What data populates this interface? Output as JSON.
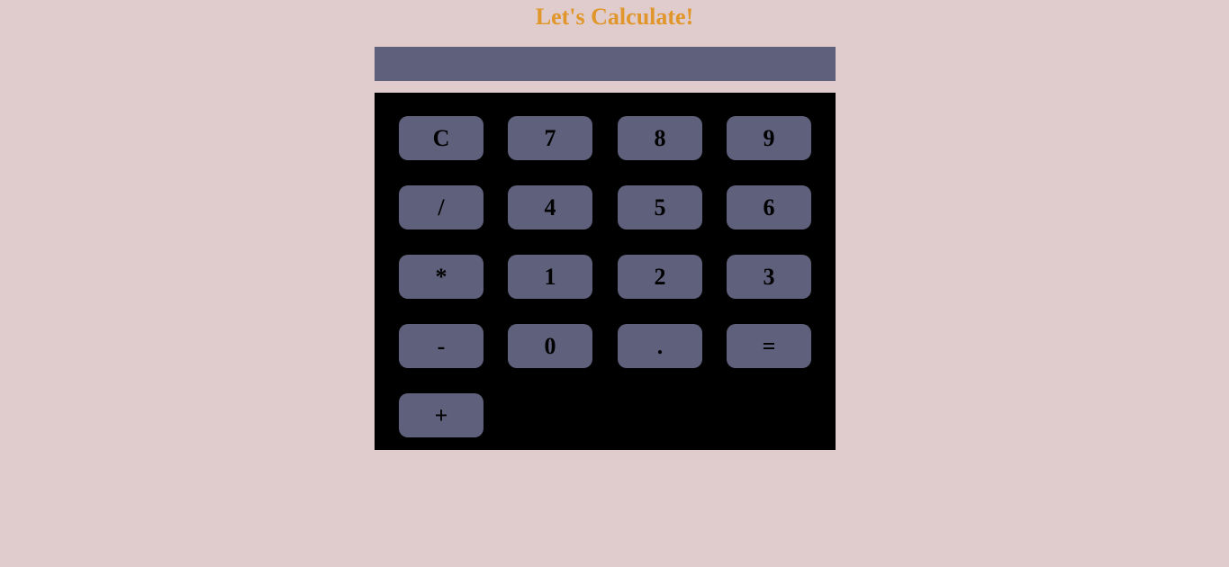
{
  "title": "Let's Calculate!",
  "display": {
    "value": ""
  },
  "keys": {
    "clear": "C",
    "seven": "7",
    "eight": "8",
    "nine": "9",
    "divide": "/",
    "four": "4",
    "five": "5",
    "six": "6",
    "multiply": "*",
    "one": "1",
    "two": "2",
    "three": "3",
    "minus": "-",
    "zero": "0",
    "decimal": ".",
    "equals": "=",
    "plus": "+"
  },
  "colors": {
    "background": "#e0cccc",
    "title": "#e0962a",
    "display": "#5f607c",
    "keypad": "#000000",
    "key": "#5f607c"
  }
}
